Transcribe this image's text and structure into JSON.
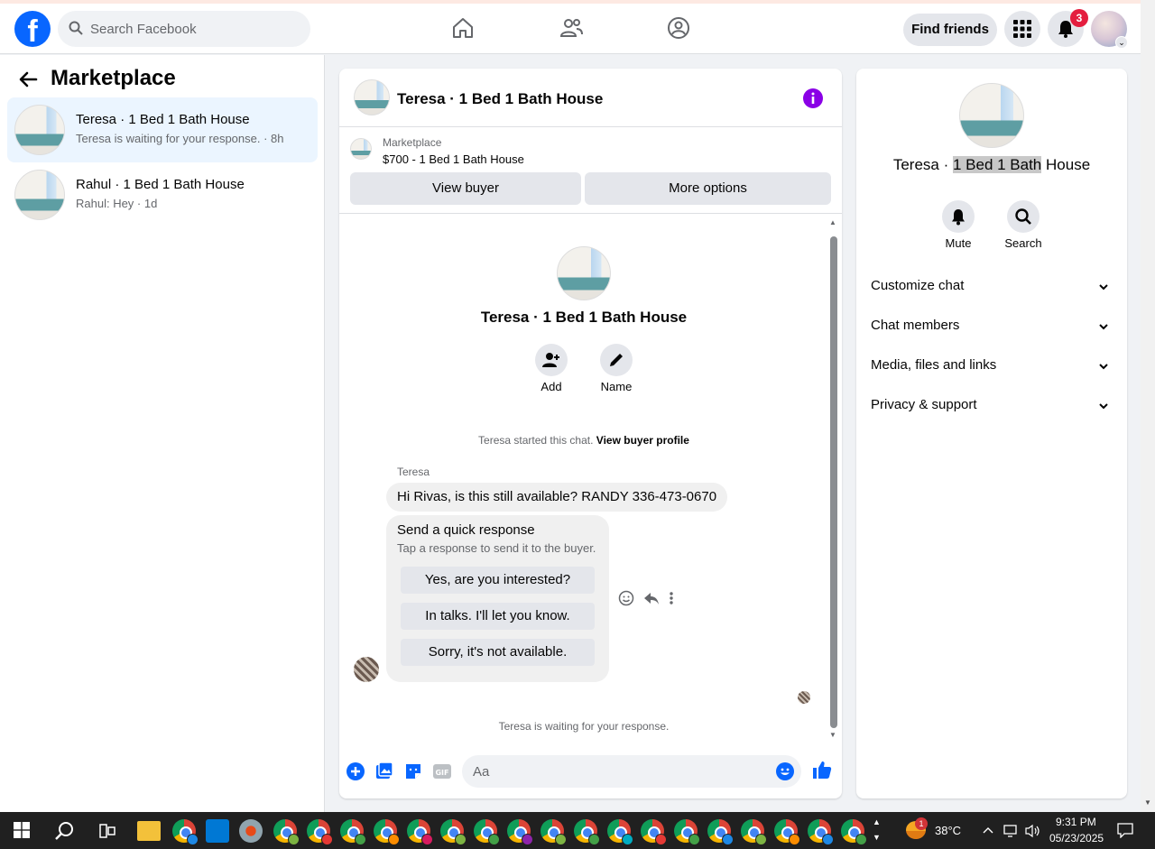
{
  "topbar": {
    "search_placeholder": "Search Facebook",
    "find_friends_label": "Find friends",
    "notification_count": "3",
    "accent_color": "#0866ff"
  },
  "left_panel": {
    "title": "Marketplace",
    "conversations": [
      {
        "name": "Teresa · 1 Bed 1 Bath House",
        "snippet": "Teresa is waiting for your response. · 8h",
        "active": true
      },
      {
        "name": "Rahul · 1 Bed 1 Bath House",
        "snippet": "Rahul: Hey · 1d",
        "active": false
      }
    ]
  },
  "chat": {
    "header_title": "Teresa · 1 Bed 1 Bath House",
    "listing_label": "Marketplace",
    "listing_price": "$700 - 1 Bed 1 Bath House",
    "view_buyer_label": "View buyer",
    "more_options_label": "More options",
    "intro_title": "Teresa · 1 Bed 1 Bath House",
    "add_label": "Add",
    "name_label": "Name",
    "started_text": "Teresa started this chat.",
    "view_profile_link": "View buyer profile",
    "sender_name": "Teresa",
    "message_text": "Hi Rivas, is this still available? RANDY 336-473-0670",
    "quick_title": "Send a quick response",
    "quick_subtitle": "Tap a response to send it to the buyer.",
    "quick_responses": [
      "Yes, are you interested?",
      "In talks. I'll let you know.",
      "Sorry, it's not available."
    ],
    "waiting_text": "Teresa is waiting for your response.",
    "composer_placeholder": "Aa"
  },
  "right_panel": {
    "title_prefix": "Teresa · ",
    "title_highlight": "1 Bed 1 Bath",
    "title_suffix": " House",
    "mute_label": "Mute",
    "search_label": "Search",
    "sections": [
      "Customize chat",
      "Chat members",
      "Media, files and links",
      "Privacy & support"
    ]
  },
  "taskbar": {
    "temperature": "38°C",
    "weather_badge": "1",
    "time": "9:31 PM",
    "date": "05/23/2025"
  }
}
